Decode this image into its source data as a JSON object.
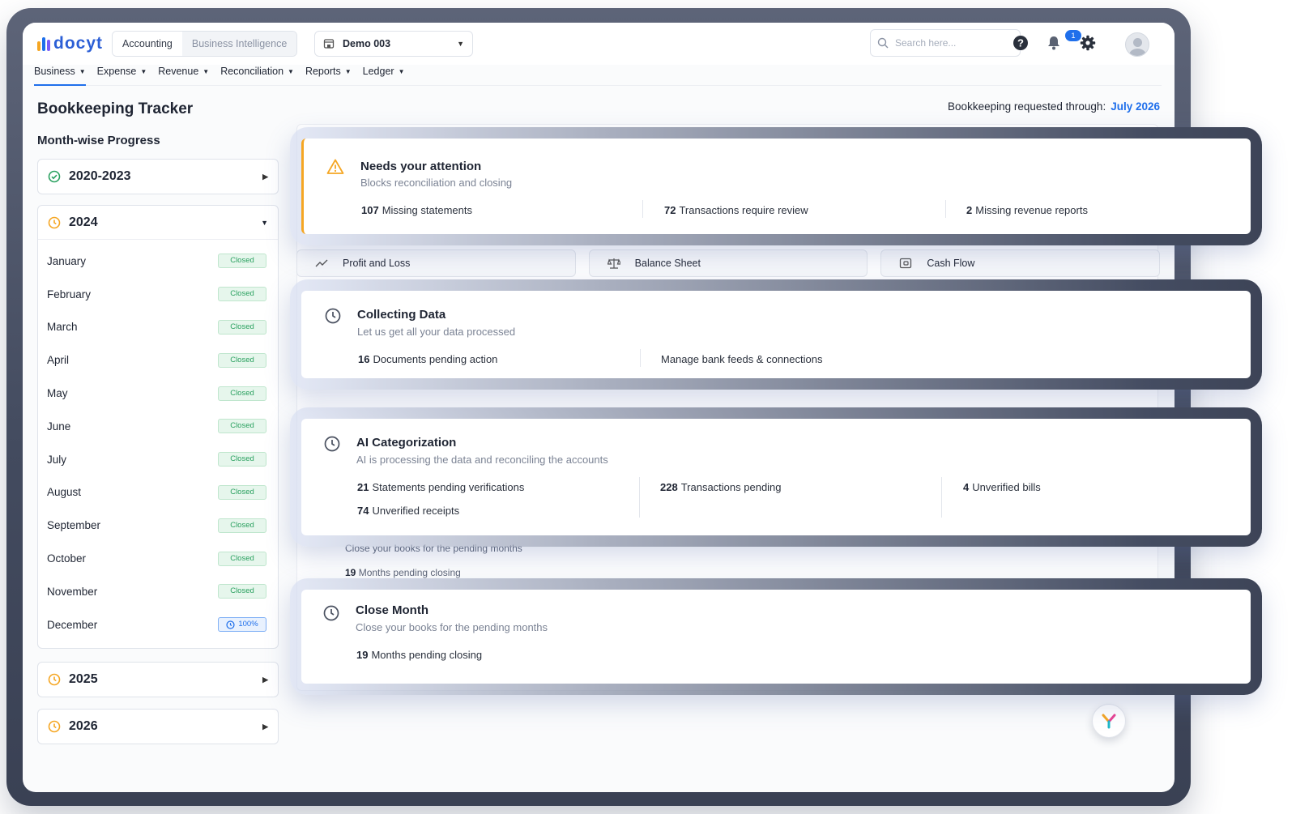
{
  "logo_text": "docyt",
  "modes": [
    "Accounting",
    "Business Intelligence"
  ],
  "business_selector": "Demo 003",
  "search_placeholder": "Search here...",
  "notification_count": "1",
  "nav": [
    "Business",
    "Expense",
    "Revenue",
    "Reconciliation",
    "Reports",
    "Ledger"
  ],
  "page_title": "Bookkeeping Tracker",
  "requested_label": "Bookkeeping requested through:",
  "requested_value": "July 2026",
  "section_title": "Month-wise Progress",
  "years": {
    "y2020": "2020-2023",
    "y2024": "2024",
    "y2025": "2025",
    "y2026": "2026"
  },
  "months": [
    {
      "name": "January",
      "status": "Closed"
    },
    {
      "name": "February",
      "status": "Closed"
    },
    {
      "name": "March",
      "status": "Closed"
    },
    {
      "name": "April",
      "status": "Closed"
    },
    {
      "name": "May",
      "status": "Closed"
    },
    {
      "name": "June",
      "status": "Closed"
    },
    {
      "name": "July",
      "status": "Closed"
    },
    {
      "name": "August",
      "status": "Closed"
    },
    {
      "name": "September",
      "status": "Closed"
    },
    {
      "name": "October",
      "status": "Closed"
    },
    {
      "name": "November",
      "status": "Closed"
    },
    {
      "name": "December",
      "status": "100%"
    }
  ],
  "report_tabs": [
    "Profit and Loss",
    "Balance Sheet",
    "Cash Flow"
  ],
  "under_close": {
    "subtitle": "Close your books for the pending months",
    "count": "19",
    "label": "Months pending closing"
  },
  "attention": {
    "title": "Needs your attention",
    "subtitle": "Blocks reconciliation and closing",
    "stats": [
      {
        "n": "107",
        "label": "Missing statements"
      },
      {
        "n": "72",
        "label": "Transactions require review"
      },
      {
        "n": "2",
        "label": "Missing revenue reports"
      }
    ]
  },
  "collecting": {
    "title": "Collecting Data",
    "subtitle": "Let us get all your data processed",
    "stat_n": "16",
    "stat_label": "Documents pending action",
    "link": "Manage bank feeds & connections"
  },
  "ai": {
    "title": "AI Categorization",
    "subtitle": "AI is processing the data and reconciling the accounts",
    "stats": [
      {
        "n": "21",
        "label": "Statements pending verifications"
      },
      {
        "n": "228",
        "label": "Transactions pending"
      },
      {
        "n": "4",
        "label": "Unverified bills"
      },
      {
        "n": "74",
        "label": "Unverified receipts"
      }
    ]
  },
  "close": {
    "title": "Close Month",
    "subtitle": "Close your books for the pending months",
    "stat_n": "19",
    "stat_label": "Months pending closing"
  },
  "colors": {
    "accent": "#1f6feb",
    "warning": "#f5a623",
    "success": "#2ba160"
  }
}
